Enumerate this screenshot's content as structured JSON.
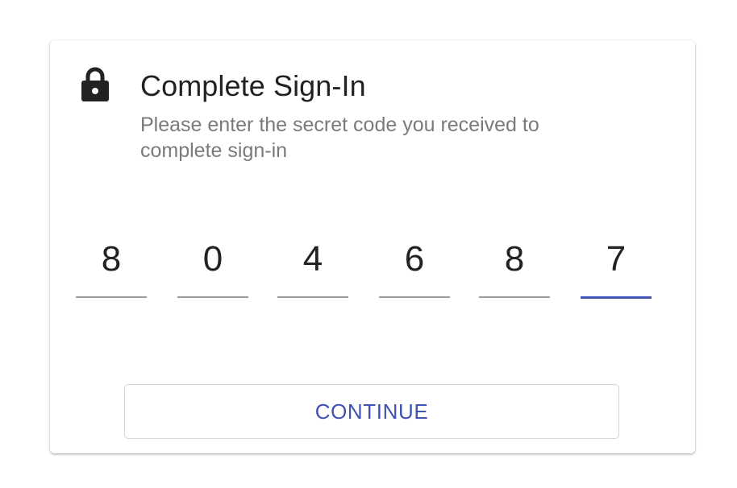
{
  "dialog": {
    "title": "Complete Sign-In",
    "subtitle": "Please enter the secret code you received to complete sign-in",
    "icon": "lock-icon"
  },
  "code": {
    "digits": [
      "8",
      "0",
      "4",
      "6",
      "8",
      "7"
    ],
    "active_index": 5
  },
  "actions": {
    "continue_label": "CONTINUE"
  },
  "colors": {
    "accent": "#3f51b5",
    "title": "#222222",
    "subtitle": "#7a7a7a",
    "underline": "#9a9a9a",
    "button_border": "#d5d5d5"
  }
}
